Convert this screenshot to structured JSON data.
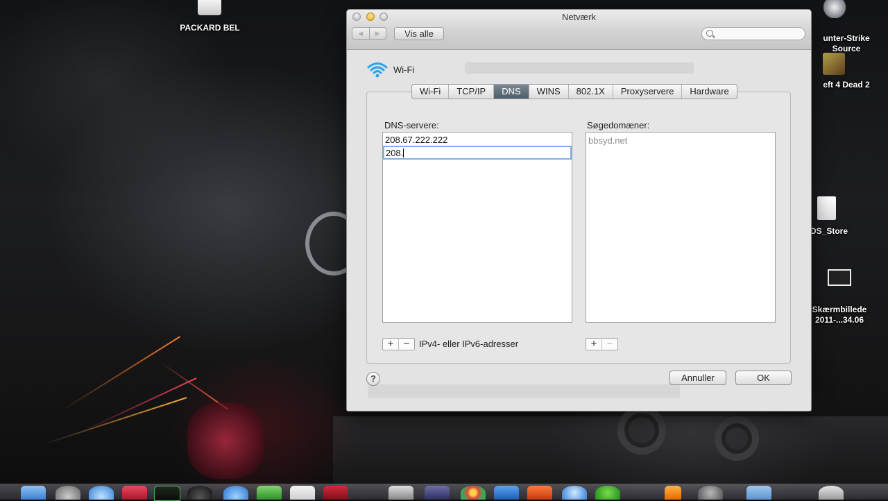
{
  "desktop": {
    "icons": [
      {
        "label": "PACKARD BEL"
      },
      {
        "label": "unter-Strike\nSource"
      },
      {
        "label": "eft 4 Dead 2"
      },
      {
        "label": "DS_Store"
      },
      {
        "label": "Skærmbillede\n2011-...34.06"
      }
    ]
  },
  "window": {
    "title": "Netværk",
    "nav_back": "◀",
    "nav_forward": "▶",
    "show_all_label": "Vis alle",
    "search_placeholder": ""
  },
  "interface": {
    "name": "Wi-Fi"
  },
  "tabs": [
    {
      "label": "Wi-Fi",
      "active": false
    },
    {
      "label": "TCP/IP",
      "active": false
    },
    {
      "label": "DNS",
      "active": true
    },
    {
      "label": "WINS",
      "active": false
    },
    {
      "label": "802.1X",
      "active": false
    },
    {
      "label": "Proxyservere",
      "active": false
    },
    {
      "label": "Hardware",
      "active": false
    }
  ],
  "dns": {
    "servers_label": "DNS-servere:",
    "servers": [
      "208.67.222.222"
    ],
    "editing_value": "208.",
    "add_label": "+",
    "remove_label": "−",
    "hint": "IPv4- eller IPv6-adresser"
  },
  "search_domains": {
    "label": "Søgedomæner:",
    "domains": [
      "bbsyd.net"
    ],
    "add_label": "+",
    "remove_label": "−"
  },
  "footer": {
    "help_label": "?",
    "cancel_label": "Annuller",
    "ok_label": "OK"
  },
  "colors": {
    "active_tab": "#5a6672",
    "focus_ring": "#7fb0e8",
    "wifi_blue": "#2aa3f0"
  }
}
